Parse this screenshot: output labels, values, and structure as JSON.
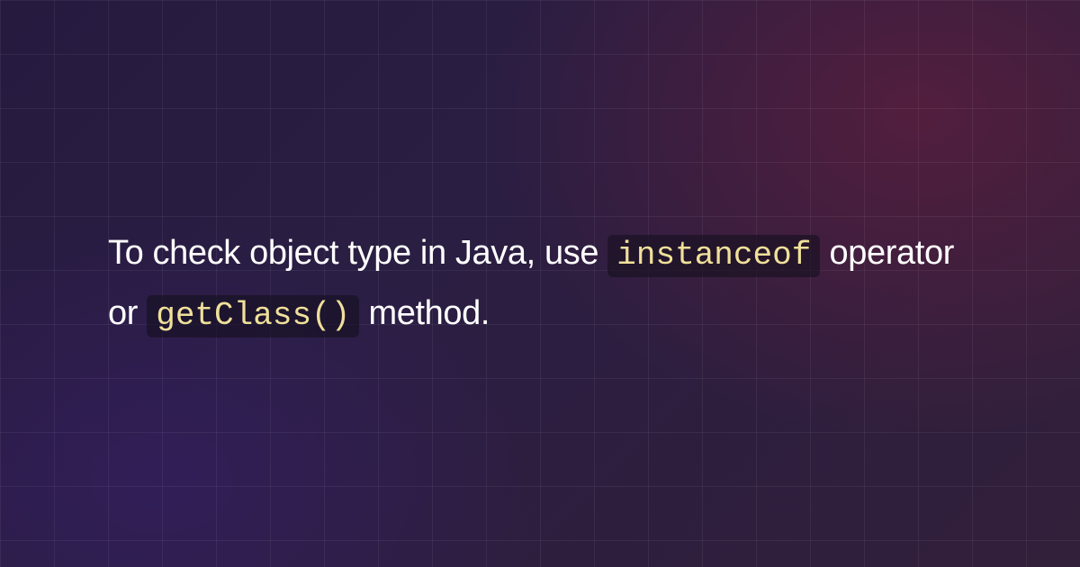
{
  "sentence": {
    "part1": "To check object type in Java, use ",
    "code1": "instanceof",
    "part2": " operator or ",
    "code2": "getClass()",
    "part3": " method."
  }
}
